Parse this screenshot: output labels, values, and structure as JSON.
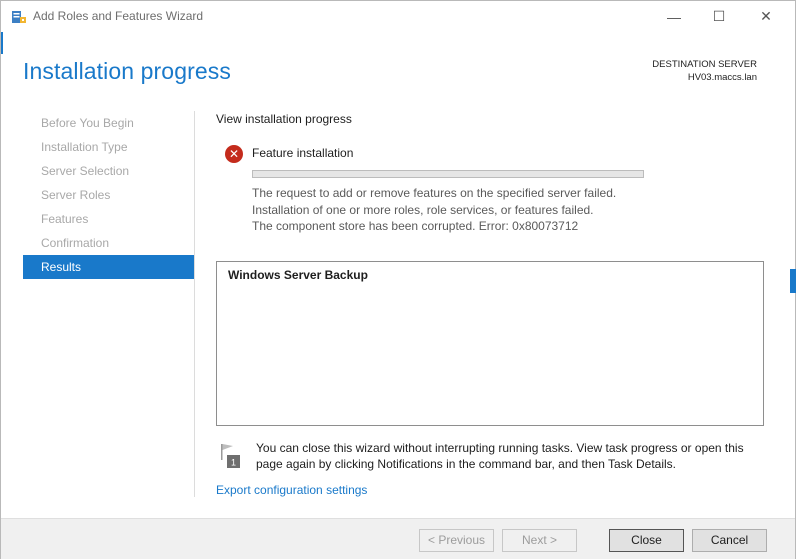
{
  "window": {
    "title": "Add Roles and Features Wizard",
    "minimize_glyph": "—",
    "maximize_glyph": "☐",
    "close_glyph": "✕"
  },
  "page": {
    "heading": "Installation progress",
    "destination_label": "DESTINATION SERVER",
    "destination_server": "HV03.maccs.lan"
  },
  "nav": {
    "items": [
      {
        "label": "Before You Begin",
        "active": false
      },
      {
        "label": "Installation Type",
        "active": false
      },
      {
        "label": "Server Selection",
        "active": false
      },
      {
        "label": "Server Roles",
        "active": false
      },
      {
        "label": "Features",
        "active": false
      },
      {
        "label": "Confirmation",
        "active": false
      },
      {
        "label": "Results",
        "active": true
      }
    ]
  },
  "progress_section": {
    "title": "View installation progress",
    "status_icon": "error-icon",
    "feature_label": "Feature installation",
    "progress_fraction": 0,
    "messages": [
      "The request to add or remove features on the specified server failed.",
      "Installation of one or more roles, role services, or features failed.",
      "The component store has been corrupted. Error: 0x80073712"
    ]
  },
  "results": {
    "items": [
      "Windows Server Backup"
    ]
  },
  "note": {
    "icon": "notification-flag-icon",
    "badge": "1",
    "text": "You can close this wizard without interrupting running tasks. View task progress or open this page again by clicking Notifications in the command bar, and then Task Details."
  },
  "export_link": "Export configuration settings",
  "footer": {
    "previous_label": "< Previous",
    "next_label": "Next >",
    "close_label": "Close",
    "cancel_label": "Cancel"
  },
  "colors": {
    "accent": "#1979ca",
    "error": "#c42b1c"
  }
}
